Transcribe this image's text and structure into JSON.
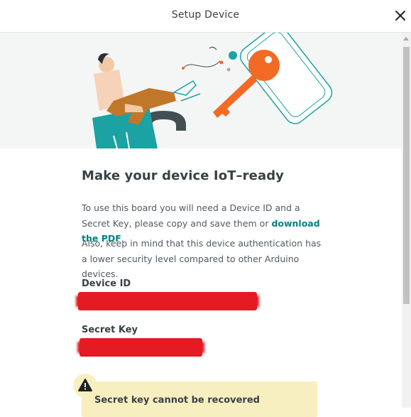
{
  "header": {
    "title": "Setup Device",
    "close_icon": "close-icon"
  },
  "main": {
    "heading": "Make your device IoT–ready",
    "paragraph1_before_link": "To use this board you will need a Device ID and a Secret Key, please copy and save them or ",
    "paragraph1_link": "download the PDF",
    "paragraph1_after_link": ".",
    "paragraph2": "Also, keep in mind that this device authentication has a lower security level compared to other Arduino devices.",
    "device_id_label": "Device ID",
    "secret_key_label": "Secret Key",
    "warning_text": "Secret key cannot be recovered",
    "warning_icon": "warning-icon"
  },
  "colors": {
    "accent": "#008184",
    "redaction": "#e41b23",
    "warning_bg": "#f8efc1",
    "illustration_orange": "#f36a24",
    "illustration_teal": "#1da2a4"
  }
}
